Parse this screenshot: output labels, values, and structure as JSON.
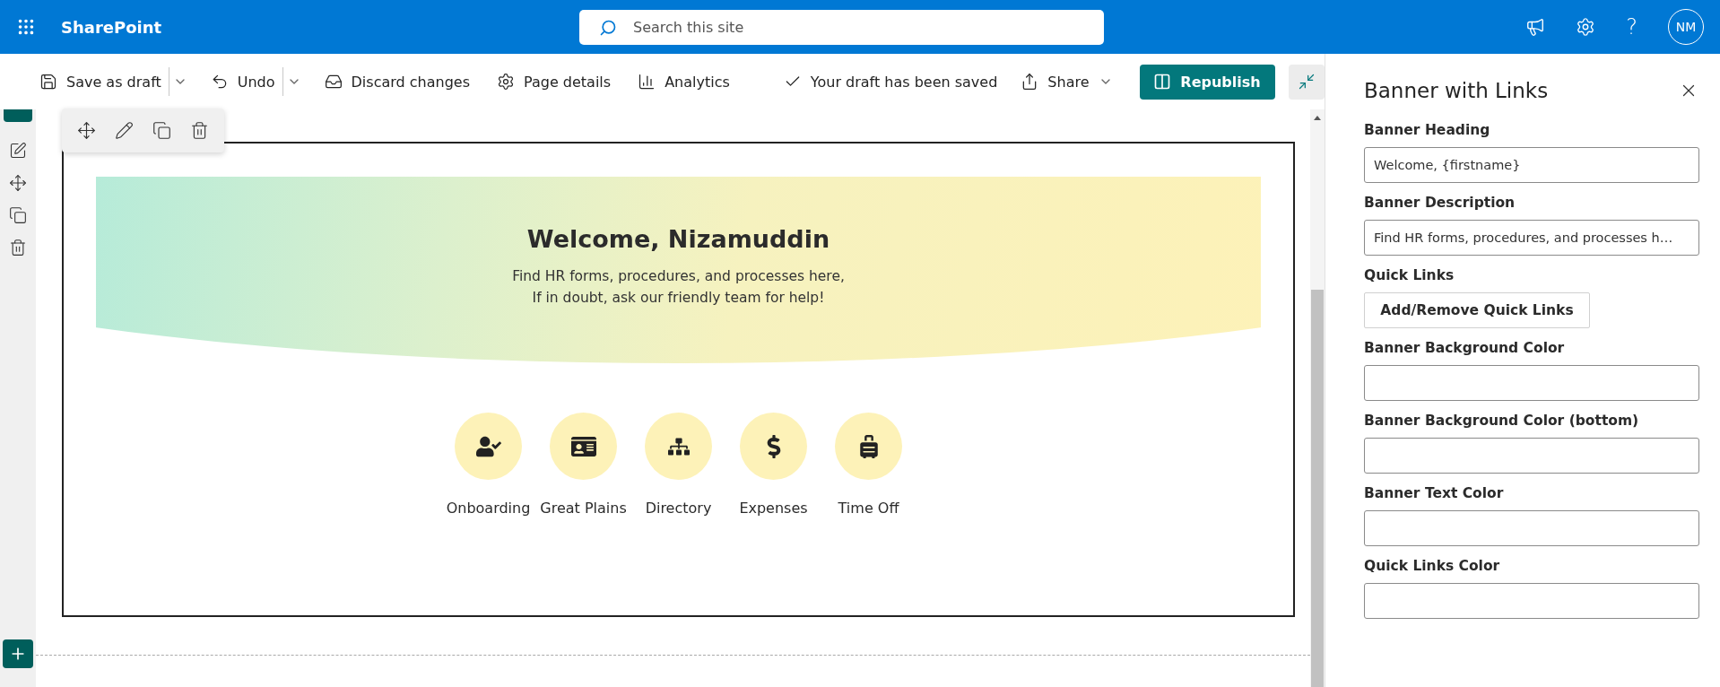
{
  "top_bar": {
    "app_name": "SharePoint",
    "search": {
      "placeholder": "Search this site"
    },
    "help": "?",
    "avatar": "NM"
  },
  "command_bar": {
    "items": [
      {
        "kind": "split",
        "label": "Save as draft"
      },
      {
        "kind": "split",
        "label": "Undo"
      },
      {
        "kind": "plain",
        "label": "Discard changes"
      },
      {
        "kind": "plain",
        "label": "Page details"
      },
      {
        "kind": "plain",
        "label": "Analytics"
      }
    ],
    "status": "Your draft has been saved",
    "share": "Share",
    "republish": "Republish"
  },
  "banner": {
    "heading": "Welcome, Nizamuddin",
    "description_lines": [
      "Find HR forms, procedures, and processes here,",
      "If in doubt, ask our friendly team for help!"
    ]
  },
  "quick_links": [
    {
      "label": "Onboarding"
    },
    {
      "label": "Great Plains"
    },
    {
      "label": "Directory"
    },
    {
      "label": "Expenses"
    },
    {
      "label": "Time Off"
    }
  ],
  "panel": {
    "title": "Banner with Links",
    "fields": [
      {
        "kind": "text",
        "label": "Banner Heading",
        "value": "Welcome, {firstname}"
      },
      {
        "kind": "text",
        "label": "Banner Description",
        "value": "Find HR forms, procedures, and processes h…"
      },
      {
        "kind": "button",
        "label": "Quick Links",
        "button": "Add/Remove Quick Links"
      },
      {
        "kind": "text",
        "label": "Banner Background Color"
      },
      {
        "kind": "text",
        "label": "Banner Background Color (bottom)"
      },
      {
        "kind": "text",
        "label": "Banner Text Color"
      },
      {
        "kind": "text",
        "label": "Quick Links Color"
      }
    ]
  }
}
